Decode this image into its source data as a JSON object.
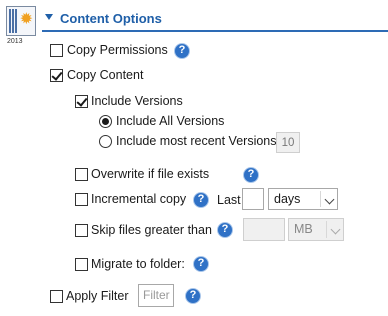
{
  "header": {
    "title": "Content Options",
    "logo_year": "2013"
  },
  "options": {
    "copy_permissions": "Copy Permissions",
    "copy_content": "Copy Content",
    "include_versions": "Include Versions",
    "include_all_versions": "Include All Versions",
    "include_most_recent": "Include most recent Versions",
    "recent_versions_count": "10",
    "overwrite": "Overwrite if file exists",
    "incremental": "Incremental copy",
    "last_label": "Last",
    "last_value": "",
    "last_unit": "days",
    "skip_files": "Skip files greater than",
    "skip_size_value": "",
    "skip_size_unit": "MB",
    "migrate_folder": "Migrate to folder:",
    "apply_filter": "Apply Filter",
    "filter_placeholder": "Filter"
  },
  "help_glyph": "?",
  "icons": {
    "help": "help-icon",
    "collapse": "collapse-arrow-icon",
    "app_logo": "app-logo-icon"
  }
}
